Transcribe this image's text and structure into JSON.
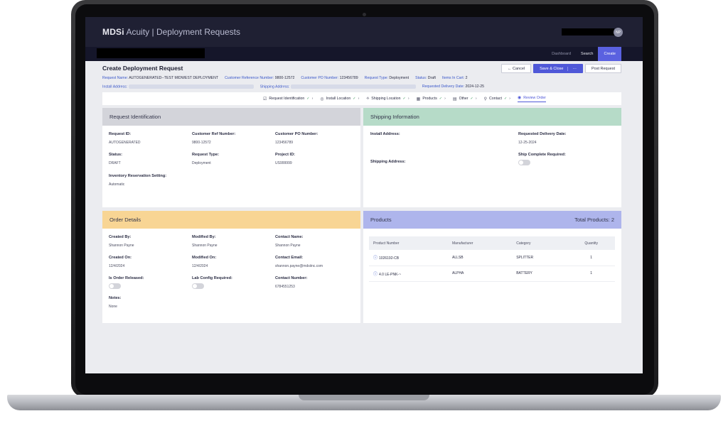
{
  "header": {
    "brand": "MDSi",
    "app_title": "Acuity | Deployment Requests",
    "avatar_initials": "NP",
    "nav": [
      "Dashboard",
      "Search",
      "Create"
    ]
  },
  "page": {
    "title": "Create Deployment Request",
    "actions": {
      "cancel": "← Cancel",
      "save_close": "Save & Close",
      "more": "···",
      "post": "Post Request"
    },
    "meta1": {
      "request_name_label": "Request Name:",
      "request_name": "AUTOGENERATED--TEST MIDWEST DEPLOYMENT",
      "cust_ref_label": "Customer Reference Number:",
      "cust_ref": "9800-12572",
      "cust_po_label": "Customer PO Number:",
      "cust_po": "123456789",
      "type_label": "Request Type:",
      "type": "Deployment",
      "status_label": "Status:",
      "status": "Draft",
      "cart_label": "Items In Cart:",
      "cart": "2"
    },
    "meta2": {
      "install_label": "Install Address:",
      "shipping_label": "Shipping Address:",
      "delivery_label": "Requested Delivery Date:",
      "delivery": "2024-12-25"
    }
  },
  "steps": [
    {
      "icon": "☑",
      "label": "Request Identification"
    },
    {
      "icon": "◎",
      "label": "Install Location"
    },
    {
      "icon": "⟡",
      "label": "Shipping Location"
    },
    {
      "icon": "▦",
      "label": "Products"
    },
    {
      "icon": "▤",
      "label": "Other"
    },
    {
      "icon": "⚲",
      "label": "Contact"
    },
    {
      "icon": "◉",
      "label": "Review Order"
    }
  ],
  "request_identification": {
    "title": "Request Identification",
    "request_id_label": "Request ID:",
    "request_id": "AUTOGENERATED",
    "cust_ref_label": "Customer Ref Number:",
    "cust_ref": "9800-12572",
    "cust_po_label": "Customer PO Number:",
    "cust_po": "123456789",
    "status_label": "Status:",
    "status": "DRAFT",
    "type_label": "Request Type:",
    "type": "Deployment",
    "project_label": "Project ID:",
    "project": "US999999",
    "inventory_label": "Inventory Reservation Setting:",
    "inventory": "Automatic"
  },
  "shipping_information": {
    "title": "Shipping Information",
    "install_label": "Install Address:",
    "delivery_label": "Requested Delivery Date:",
    "delivery": "12-25-2024",
    "ship_complete_label": "Ship Complete Required:",
    "shipping_label": "Shipping Address:"
  },
  "order_details": {
    "title": "Order Details",
    "created_by_label": "Created By:",
    "created_by": "Shannon Payne",
    "modified_by_label": "Modified By:",
    "modified_by": "Shannon Payne",
    "contact_name_label": "Contact Name:",
    "contact_name": "Shannon Payne",
    "created_on_label": "Created On:",
    "created_on": "12/4/2024",
    "modified_on_label": "Modified On:",
    "modified_on": "12/4/2024",
    "contact_email_label": "Contact Email:",
    "contact_email": "shannon.payne@mdsiinc.com",
    "released_label": "Is Order Released:",
    "lab_label": "Lab Config Required:",
    "contact_number_label": "Contact Number:",
    "contact_number": "6784551253",
    "notes_label": "Notes:",
    "notes": "None"
  },
  "products": {
    "title": "Products",
    "total": "Total Products: 2",
    "columns": [
      "Product Number",
      "Manufacturer",
      "Category",
      "Quantity"
    ],
    "rows": [
      {
        "product": "1026192-CB",
        "manufacturer": "ALLSB",
        "category": "SPLITTER",
        "quantity": "1"
      },
      {
        "product": "4.0 LE-PNK-~",
        "manufacturer": "ALPHA",
        "category": "BATTERY",
        "quantity": "1"
      }
    ]
  }
}
